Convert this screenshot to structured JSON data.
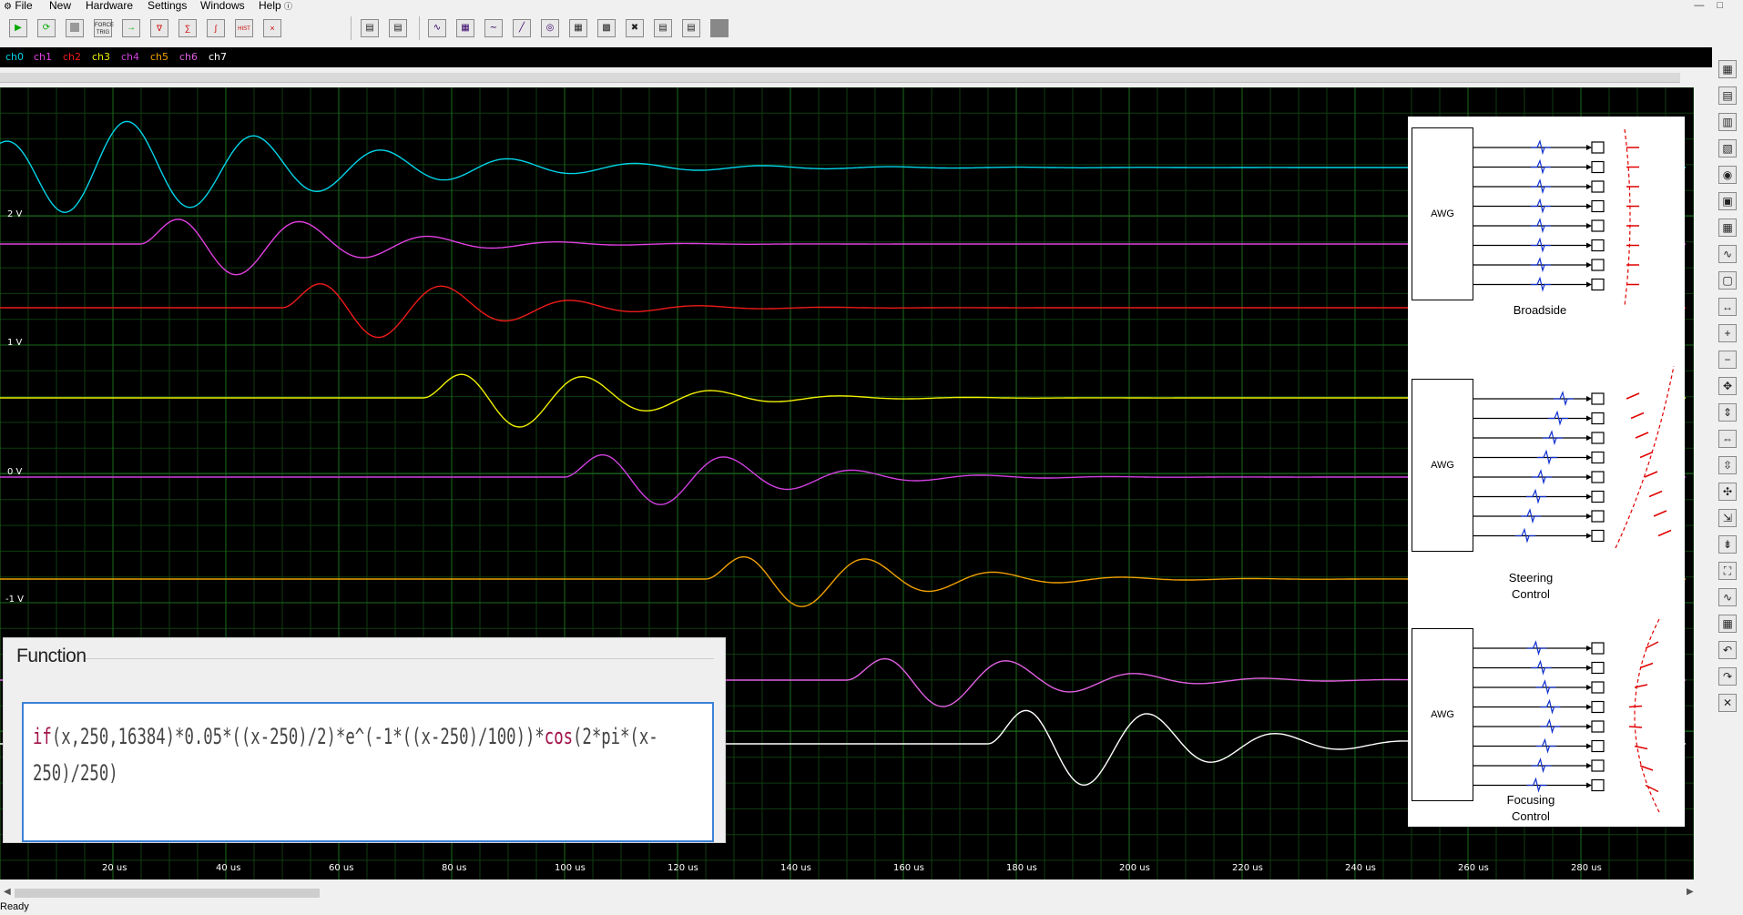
{
  "menu": [
    "File",
    "New",
    "Hardware",
    "Settings",
    "Windows",
    "Help"
  ],
  "toolbar": {
    "icons": [
      "run-icon",
      "refresh-icon",
      "stop-icon",
      "force-trigger-icon",
      "export-icon",
      "measure-icon",
      "fft-icon",
      "log-icon",
      "hist-icon",
      "clear-icon",
      "single-panel-icon",
      "split-panel-icon",
      "waveform-icon",
      "grid-icon",
      "spectrum-icon",
      "slope-icon",
      "xy-icon",
      "quad-icon",
      "invert-icon",
      "cross-icon",
      "layout-1-icon",
      "layout-2-icon",
      "layout-3-icon"
    ],
    "force_trig_label": "FORCE TRIG",
    "hist_label": "HIST"
  },
  "channels": [
    {
      "name": "ch0",
      "color": "#00d4e8"
    },
    {
      "name": "ch1",
      "color": "#e040e0"
    },
    {
      "name": "ch2",
      "color": "#ee1a1a"
    },
    {
      "name": "ch3",
      "color": "#f0f000"
    },
    {
      "name": "ch4",
      "color": "#d040e0"
    },
    {
      "name": "ch5",
      "color": "#f0a000"
    },
    {
      "name": "ch6",
      "color": "#e060e0"
    },
    {
      "name": "ch7",
      "color": "#ffffff"
    }
  ],
  "y_labels": [
    "2 V",
    "1 V",
    "0 V",
    "-1 V"
  ],
  "x_labels": [
    "20 us",
    "40 us",
    "60 us",
    "80 us",
    "100 us",
    "120 us",
    "140 us",
    "160 us",
    "180 us",
    "200 us",
    "220 us",
    "240 us",
    "260 us",
    "280 us"
  ],
  "diagram": {
    "panels": [
      {
        "awg_label": "AWG",
        "caption": "Broadside"
      },
      {
        "awg_label": "AWG",
        "caption": "Steering\nControl"
      },
      {
        "awg_label": "AWG",
        "caption": "Focusing\nControl"
      }
    ]
  },
  "function_panel": {
    "title": "Function",
    "expression": "if(x,250,16384)*0.05*((x-250)/2)*e^(-1*((x-250)/100))*cos(2*pi*(x-250)/250)"
  },
  "status": "Ready",
  "right_tools": [
    "grid-view-icon",
    "abc-icon",
    "channels-icon",
    "book-icon",
    "camera-icon",
    "step-icon",
    "table-icon",
    "plot-icon",
    "window-icon",
    "fit-width-icon",
    "zoom-in-icon",
    "zoom-out-icon",
    "move-all-icon",
    "expand-vertical-icon",
    "expand-horizontal-icon",
    "compress-vertical-icon",
    "compress-all-icon",
    "shrink-icon",
    "fit-vertical-icon",
    "fit-all-icon",
    "sine-icon",
    "multi-grid-icon",
    "undo-icon",
    "redo-icon",
    "close-x-icon"
  ]
}
